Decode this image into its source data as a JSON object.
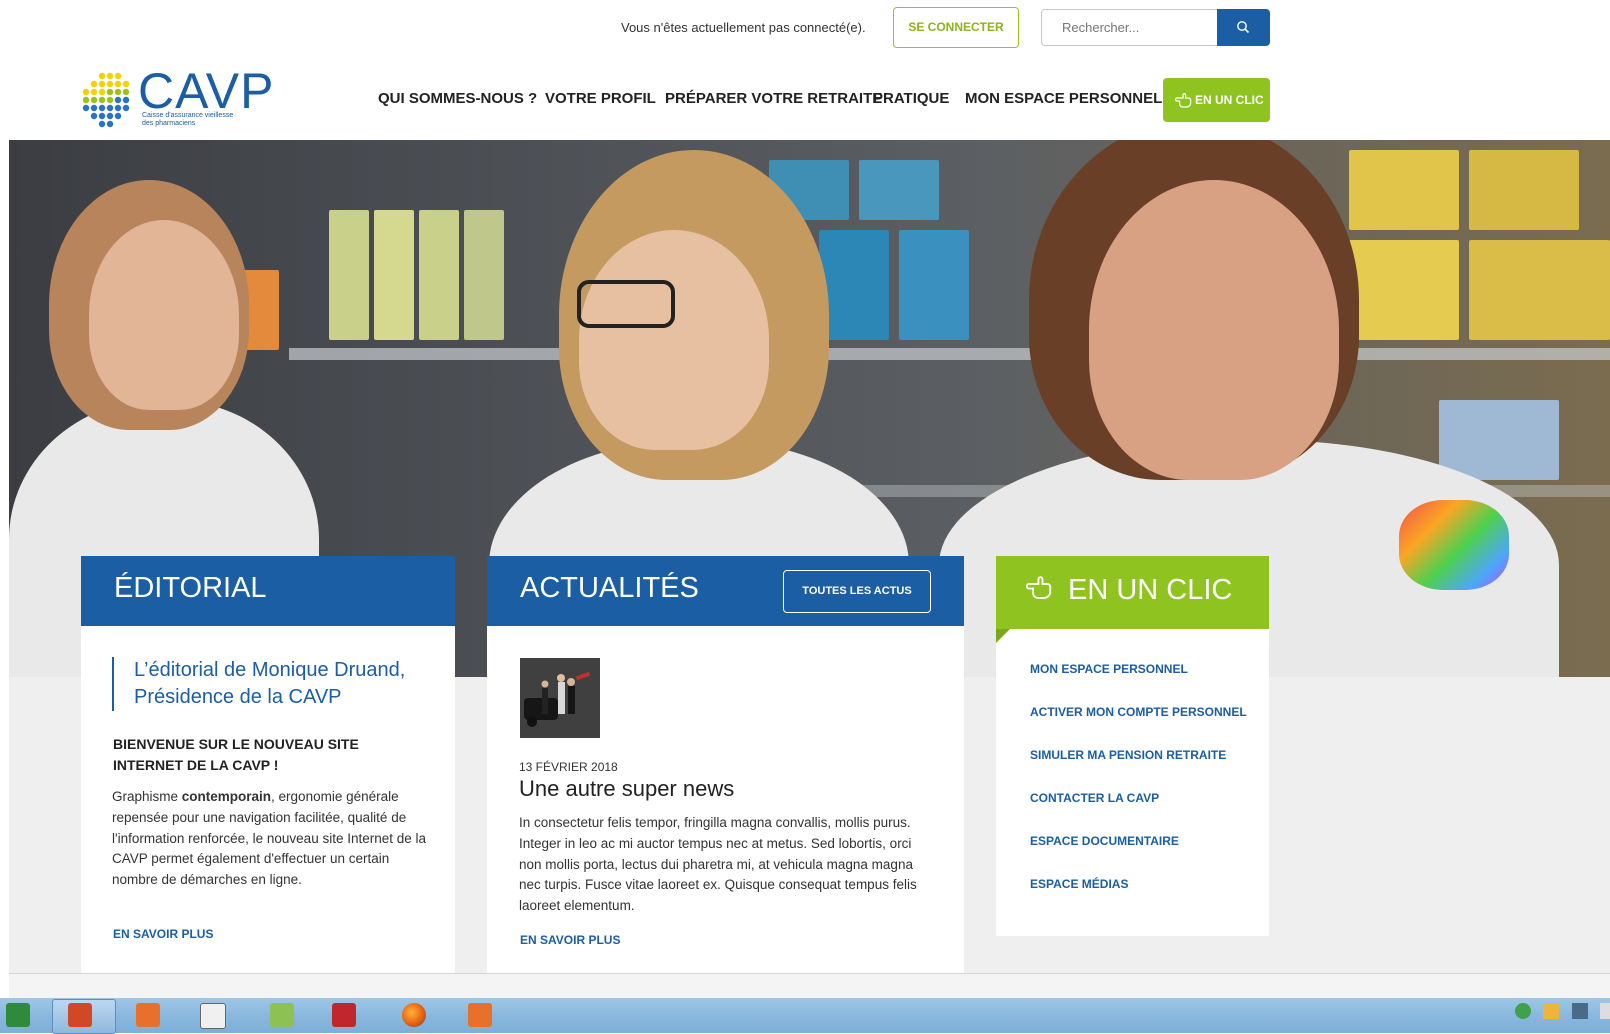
{
  "topbar": {
    "status": "Vous n'êtes actuellement pas connecté(e).",
    "connect_label": "SE CONNECTER",
    "search_placeholder": "Rechercher..."
  },
  "logo": {
    "name": "CAVP",
    "tagline_1": "Caisse d'assurance vieillesse",
    "tagline_2": "des pharmaciens"
  },
  "nav": {
    "items": [
      "QUI SOMMES-NOUS ?",
      "VOTRE PROFIL",
      "PRÉPARER VOTRE RETRAITE",
      "PRATIQUE",
      "MON ESPACE PERSONNEL"
    ],
    "cta_label": "EN UN CLIC"
  },
  "editorial": {
    "heading": "ÉDITORIAL",
    "quote_line1": "L’éditorial de Monique Druand,",
    "quote_line2": "Présidence de la CAVP",
    "subtitle": "BIENVENUE SUR LE NOUVEAU SITE INTERNET DE LA CAVP !",
    "text_before": "Graphisme ",
    "text_bold": "contemporain",
    "text_after": ", ergonomie générale repensée pour une navigation facilitée, qualité de l'information renforcée, le nouveau site Internet de la CAVP permet également d'effectuer un certain nombre de démarches en ligne.",
    "more": "EN SAVOIR PLUS"
  },
  "news": {
    "heading": "ACTUALITÉS",
    "all_label": "TOUTES LES ACTUS",
    "date": "13 FÉVRIER 2018",
    "title": "Une autre super news",
    "text": "In consectetur felis tempor, fringilla magna convallis, mollis purus. Integer in leo ac mi auctor tempus nec at metus. Sed lobortis, orci non mollis porta, lectus dui pharetra mi, at vehicula magna magna nec turpis. Fusce vitae laoreet ex. Quisque consequat tempus felis laoreet elementum.",
    "more": "EN SAVOIR PLUS"
  },
  "clic": {
    "heading": "EN UN CLIC",
    "links": [
      "MON ESPACE PERSONNEL",
      "ACTIVER MON COMPTE PERSONNEL",
      "SIMULER MA PENSION RETRAITE",
      "CONTACTER LA CAVP",
      "ESPACE DOCUMENTAIRE",
      "ESPACE MÉDIAS"
    ]
  },
  "colors": {
    "brand_blue": "#1b5ea3",
    "brand_green": "#8fc31f"
  },
  "taskbar": {
    "icons": [
      "excel-icon",
      "powerpoint-icon",
      "app-orange-icon",
      "printer-icon",
      "spreadsheet-icon",
      "filezilla-icon",
      "firefox-icon",
      "app-orange-icon"
    ]
  }
}
